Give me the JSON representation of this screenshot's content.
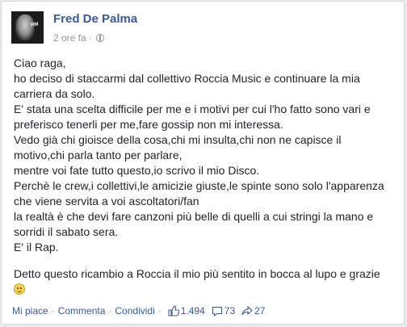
{
  "post": {
    "author": "Fred De Palma",
    "time": "2 ore fa",
    "separator": "·",
    "avatar_logo": "Roccia Music",
    "paragraphs": [
      [
        "Ciao raga,",
        "ho deciso di staccarmi dal collettivo Roccia Music e continuare la mia",
        "carriera da solo.",
        "E' stata una scelta difficile per me e i motivi per cui l'ho fatto sono vari e",
        "preferisco tenerli per me,fare gossip non mi interessa.",
        "Vedo già chi gioisce della cosa,chi mi insulta,chi non ne capisce il",
        "motivo,chi parla tanto per parlare,",
        "mentre voi fate tutto questo,io scrivo il mio Disco.",
        "Perchè le crew,i collettivi,le amicizie giuste,le spinte sono solo l'apparenza",
        "che viene servita a voi ascoltatori/fan",
        "la realtà è che devi fare canzoni più belle di quelli a cui stringi la mano e",
        "sorridi il sabato sera.",
        "E' il Rap."
      ],
      [
        "Detto questo ricambio a Roccia il mio più sentito in bocca al lupo e grazie"
      ]
    ],
    "emoji": "smile-emoji"
  },
  "footer": {
    "like": "Mi piace",
    "comment": "Commenta",
    "share": "Condividi",
    "dot": "·",
    "likes_count": "1.494",
    "comments_count": "73",
    "shares_count": "27"
  },
  "colors": {
    "link": "#3b5998",
    "text": "#1d2129",
    "meta": "#90949c"
  }
}
